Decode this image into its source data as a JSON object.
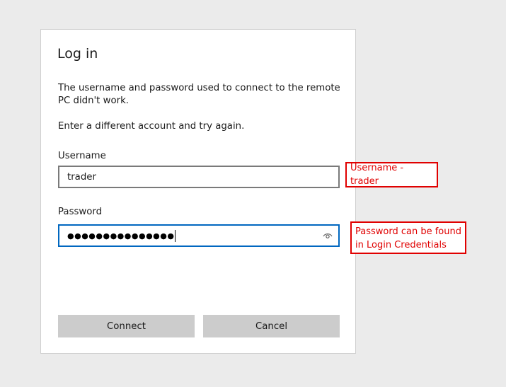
{
  "dialog": {
    "title": "Log in",
    "message_line1": "The username and password used to connect to the remote PC didn't work.",
    "message_line2": "Enter a different account and try again.",
    "username": {
      "label": "Username",
      "value": "trader"
    },
    "password": {
      "label": "Password",
      "masked_value": "●●●●●●●●●●●●●●●",
      "reveal_icon": "eye-icon"
    },
    "buttons": {
      "connect": "Connect",
      "cancel": "Cancel"
    }
  },
  "annotations": {
    "username_note": "Username - trader",
    "password_note_line1": "Password can be found",
    "password_note_line2": "in Login Credentials",
    "color": "#e00000"
  },
  "colors": {
    "focus_border": "#0067c0",
    "button_bg": "#cccccc",
    "page_bg": "#ebebeb"
  }
}
